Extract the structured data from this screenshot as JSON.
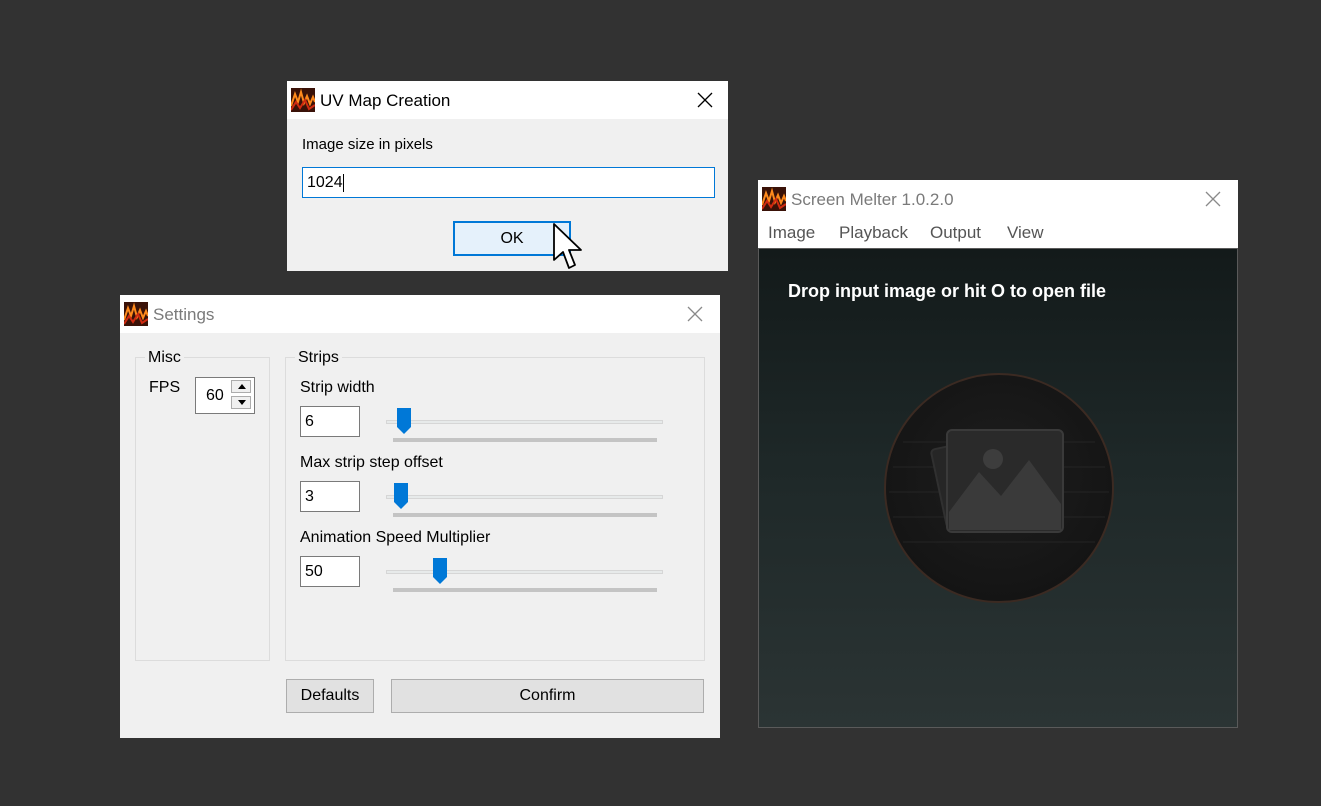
{
  "uv_dialog": {
    "title": "UV Map Creation",
    "prompt": "Image size in pixels",
    "size_value": "1024",
    "ok_label": "OK"
  },
  "settings": {
    "title": "Settings",
    "misc": {
      "group_label": "Misc",
      "fps_label": "FPS",
      "fps_value": "60"
    },
    "strips": {
      "group_label": "Strips",
      "strip_width_label": "Strip width",
      "strip_width_value": "6",
      "strip_width_slider": 0.04,
      "max_step_label": "Max strip step offset",
      "max_step_value": "3",
      "max_step_slider": 0.03,
      "anim_speed_label": "Animation Speed Multiplier",
      "anim_speed_value": "50",
      "anim_speed_slider": 0.18
    },
    "defaults_label": "Defaults",
    "confirm_label": "Confirm"
  },
  "main_window": {
    "title": "Screen Melter 1.0.2.0",
    "menu": [
      "Image",
      "Playback",
      "Output",
      "View"
    ],
    "hint": "Drop input image or hit O to open file"
  },
  "colors": {
    "desktop": "#323232",
    "accent": "#0078d7",
    "canvas": "#1c2424"
  }
}
